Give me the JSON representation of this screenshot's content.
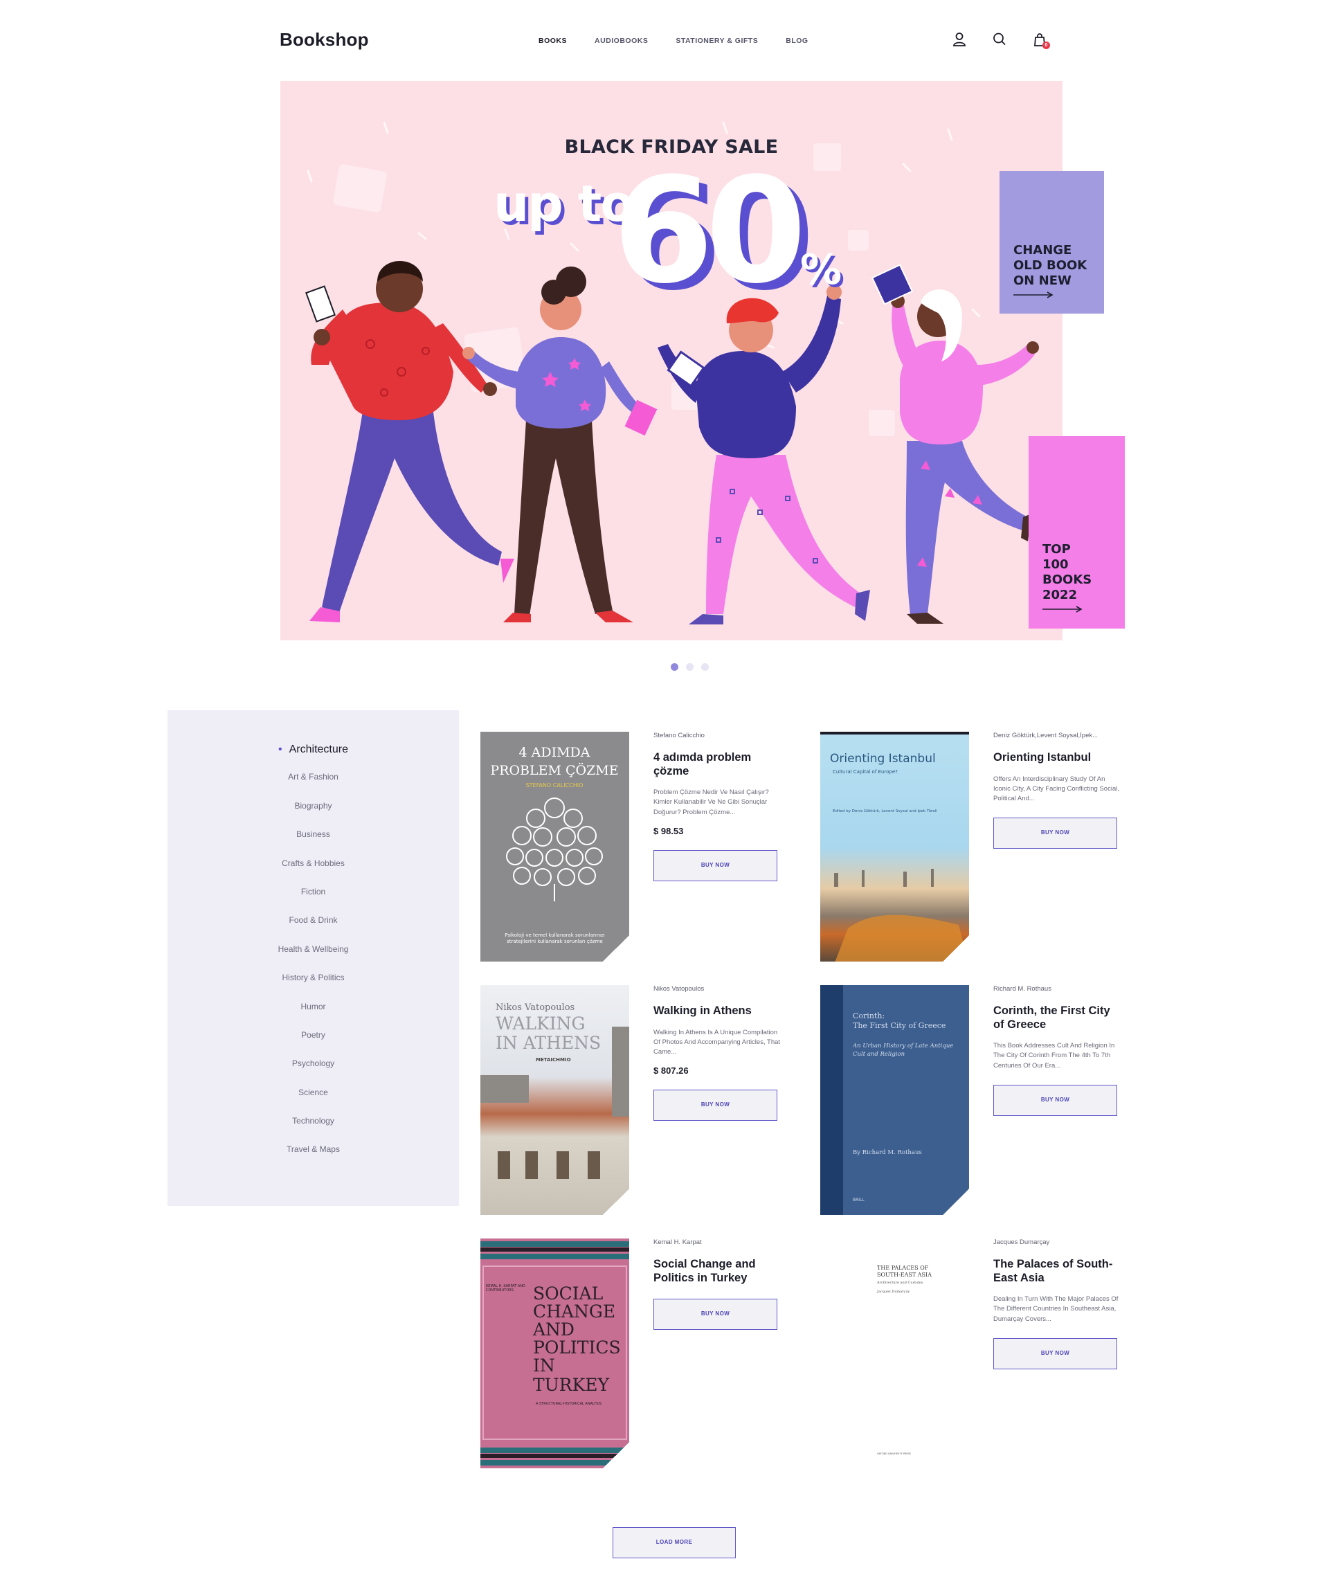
{
  "header": {
    "logo": "Bookshop",
    "nav": [
      {
        "label": "BOOKS",
        "active": true
      },
      {
        "label": "AUDIOBOOKS"
      },
      {
        "label": "STATIONERY & GIFTS"
      },
      {
        "label": "BLOG"
      }
    ],
    "icons": [
      "user-icon",
      "search-icon",
      "shopping-bag-icon"
    ],
    "cart_count": "0"
  },
  "hero": {
    "title": "BLACK FRIDAY SALE",
    "upto": "up to",
    "percent_value": "60",
    "percent_sign": "%",
    "promos": [
      {
        "lines": [
          "CHANGE",
          "OLD BOOK",
          "ON NEW"
        ]
      },
      {
        "lines": [
          "TOP",
          "100",
          "BOOKS",
          "2022"
        ]
      }
    ],
    "slide_count": 3,
    "active_slide": 1
  },
  "categories": {
    "active": "Architecture",
    "items": [
      "Architecture",
      "Art & Fashion",
      "Biography",
      "Business",
      "Crafts & Hobbies",
      "Fiction",
      "Food & Drink",
      "Health & Wellbeing",
      "History & Politics",
      "Humor",
      "Poetry",
      "Psychology",
      "Science",
      "Technology",
      "Travel & Maps"
    ]
  },
  "products": [
    {
      "author": "Stefano Calicchio",
      "title": "4 adımda problem çözme",
      "desc": "Problem Çözme Nedir Ve Nasıl Çalışır? Kimler Kullanabilir Ve Ne Gibi Sonuçlar Doğurur? Problem Çözme...",
      "price": "$ 98.53",
      "button": "BUY NOW",
      "cover": {
        "lines": [
          "4 ADIMDA",
          "PROBLEM ÇÖZME"
        ],
        "subtitle": "STEFANO CALICCHIO",
        "footer": "Psikoloji ve temel kullanarak sorunlarınızı stratejilerini kullanarak sorunları çözme",
        "bg": "#8b8b8d",
        "accent": "#e6c84a"
      }
    },
    {
      "author": "Deniz Göktürk,Levent Soysal,İpek...",
      "title": "Orienting Istanbul",
      "desc": "Offers An Interdisciplinary Study Of An Iconic City, A City Facing Conflicting Social, Political And...",
      "price": "",
      "button": "BUY NOW",
      "cover": {
        "lines": [
          "Orienting Istanbul"
        ],
        "subtitle": "Cultural Capital of Europe?",
        "footer": "Edited by Deniz Göktürk, Levent Soysal and İpek Türeli",
        "bg": "#a9d7ee",
        "accent": "#2a5880"
      }
    },
    {
      "author": "Nikos Vatopoulos",
      "title": "Walking in Athens",
      "desc": "Walking In Athens Is A Unique Compilation Of Photos And Accompanying Articles, That Came...",
      "price": "$ 807.26",
      "button": "BUY NOW",
      "cover": {
        "lines": [
          "Nikos Vatopoulos",
          "WALKING",
          "IN ATHENS"
        ],
        "subtitle": "METAICHMIO",
        "footer": "",
        "bg": "#e3e5ea",
        "accent": "#6f6f78"
      }
    },
    {
      "author": "Richard M. Rothaus",
      "title": "Corinth, the First City of Greece",
      "desc": "This Book Addresses Cult And Religion In The City Of Corinth From The 4th To 7th Centuries Of Our Era...",
      "price": "",
      "button": "BUY NOW",
      "cover": {
        "lines": [
          "Corinth:",
          "The First City of Greece"
        ],
        "subtitle": "An Urban History of Late Antique Cult and Religion",
        "footer": "By Richard M. Rothaus",
        "publisher": "BRILL",
        "bg": "#3d5f8f",
        "accent": "#d2dced"
      }
    },
    {
      "author": "Kemal H. Karpat",
      "title": "Social Change and Politics in Turkey",
      "desc": "",
      "price": "",
      "button": "BUY NOW",
      "cover": {
        "lines": [
          "SOCIAL",
          "CHANGE",
          "AND",
          "POLITICS",
          "IN",
          "TURKEY"
        ],
        "subtitle": "A STRUCTURAL-HISTORICAL ANALYSIS",
        "footer": "KEMAL H. KARPAT AND CONTRIBUTORS",
        "bg": "#c66f93",
        "accent": "#2a1f28"
      }
    },
    {
      "author": "Jacques Dumarçay",
      "title": "The Palaces of South-East Asia",
      "desc": "Dealing In Turn With The Major Palaces Of The Different Countries In Southeast Asia, Dumarçay Covers...",
      "price": "",
      "button": "BUY NOW",
      "cover": {
        "lines": [
          "THE PALACES OF",
          "SOUTH-EAST ASIA"
        ],
        "subtitle": "Architecture and Customs",
        "footer": "Jacques Dumarçay",
        "publisher": "OXFORD UNIVERSITY PRESS",
        "bg": "#ffffff",
        "accent": "#333333"
      }
    }
  ],
  "load_more": "LOAD MORE"
}
